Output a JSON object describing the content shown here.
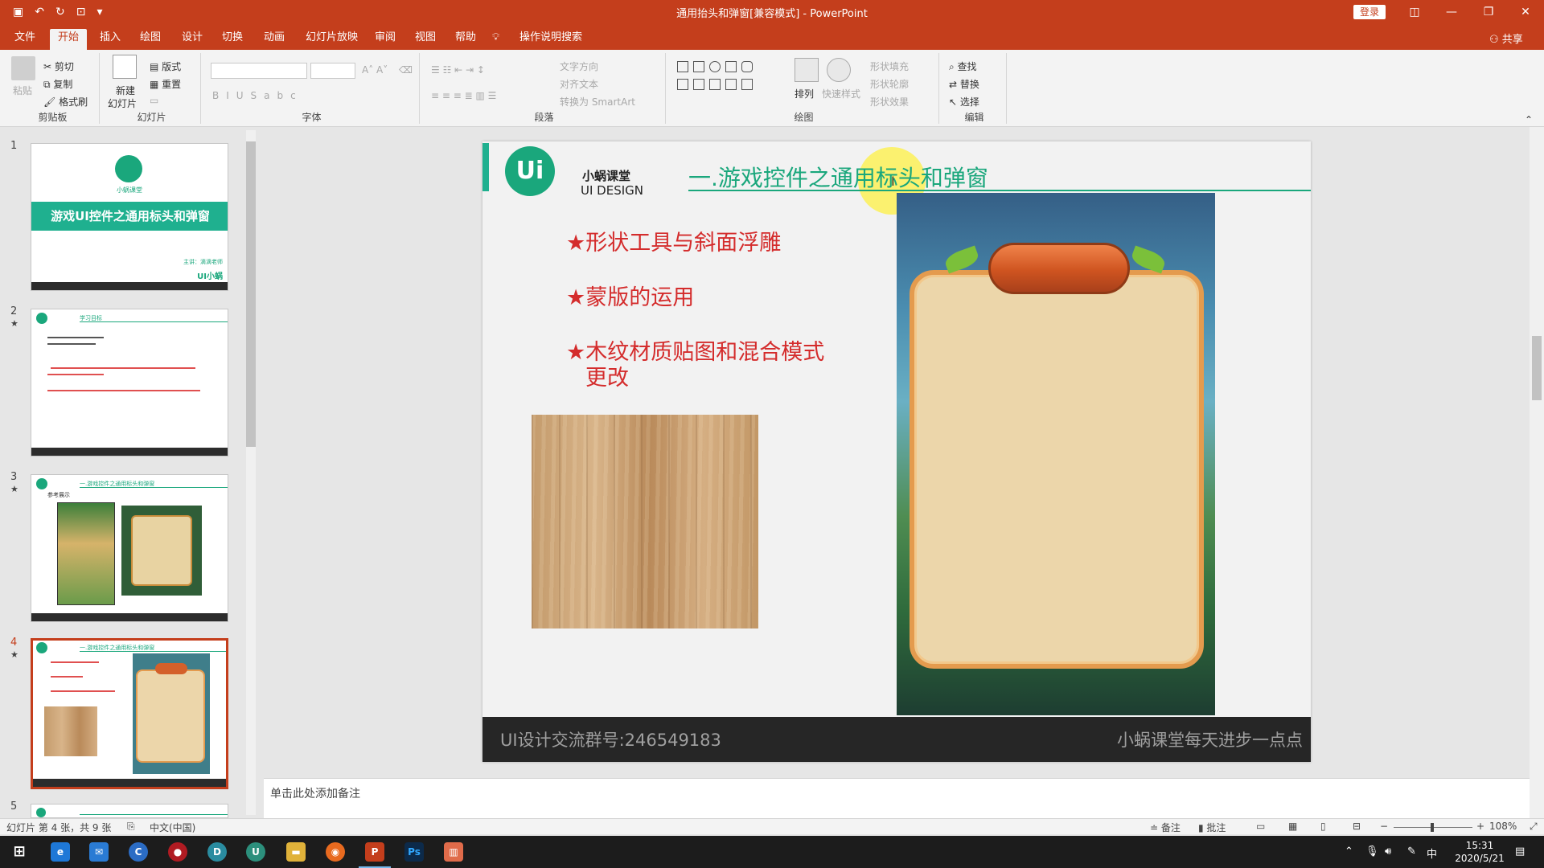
{
  "window": {
    "title": "通用抬头和弹窗[兼容模式] - PowerPoint",
    "login": "登录"
  },
  "tabs": [
    "文件",
    "开始",
    "插入",
    "绘图",
    "设计",
    "切换",
    "动画",
    "幻灯片放映",
    "审阅",
    "视图",
    "帮助",
    "操作说明搜索"
  ],
  "share": "共享",
  "ribbon": {
    "clipboard": {
      "label": "剪贴板",
      "paste": "粘贴",
      "cut": "剪切",
      "copy": "复制",
      "format_painter": "格式刷"
    },
    "slides": {
      "label": "幻灯片",
      "new_slide": "新建",
      "new_slide2": "幻灯片",
      "layout": "版式",
      "reset": "重置"
    },
    "font": {
      "label": "字体"
    },
    "paragraph": {
      "label": "段落",
      "text_direction": "文字方向",
      "align_text": "对齐文本",
      "smartart": "转换为 SmartArt"
    },
    "drawing": {
      "label": "绘图",
      "arrange": "排列",
      "quick_styles": "快速样式",
      "shape_fill": "形状填充",
      "shape_outline": "形状轮廓",
      "shape_effect": "形状效果"
    },
    "editing": {
      "label": "编辑",
      "find": "查找",
      "replace": "替换",
      "select": "选择"
    }
  },
  "thumbnails": [
    {
      "num": "1",
      "title": "游戏UI控件之通用标头和弹窗",
      "brand": "小蜗课堂",
      "presenter": "主讲：滴滴老师",
      "mini_logo": "UI小蜗"
    },
    {
      "num": "2",
      "header": "学习目标"
    },
    {
      "num": "3",
      "header": "一.游戏控件之通用标头和弹窗",
      "subtitle": "参考展示"
    },
    {
      "num": "4",
      "header": "一.游戏控件之通用标头和弹窗"
    },
    {
      "num": "5"
    }
  ],
  "slide": {
    "brand_cn": "小蜗课堂",
    "brand_en": "UI DESIGN",
    "logo": "Ui",
    "title": "一.游戏控件之通用标头和弹窗",
    "bullets": [
      "★形状工具与斜面浮雕",
      "★蒙版的运用",
      "★木纹材质贴图和混合模式",
      "更改"
    ],
    "footer_left": "UI设计交流群号:246549183",
    "footer_right": "小蜗课堂每天进步一点点"
  },
  "notes_placeholder": "单击此处添加备注",
  "status": {
    "slide_info": "幻灯片 第 4 张，共 9 张",
    "language": "中文(中国)",
    "notes": "备注",
    "comments": "批注",
    "zoom": "108%"
  },
  "taskbar": {
    "time": "15:31",
    "date": "2020/5/21",
    "ime": "中"
  },
  "colors": {
    "accent": "#c43e1c",
    "brand_green": "#1aa77c",
    "bullet_red": "#d42c2c"
  }
}
